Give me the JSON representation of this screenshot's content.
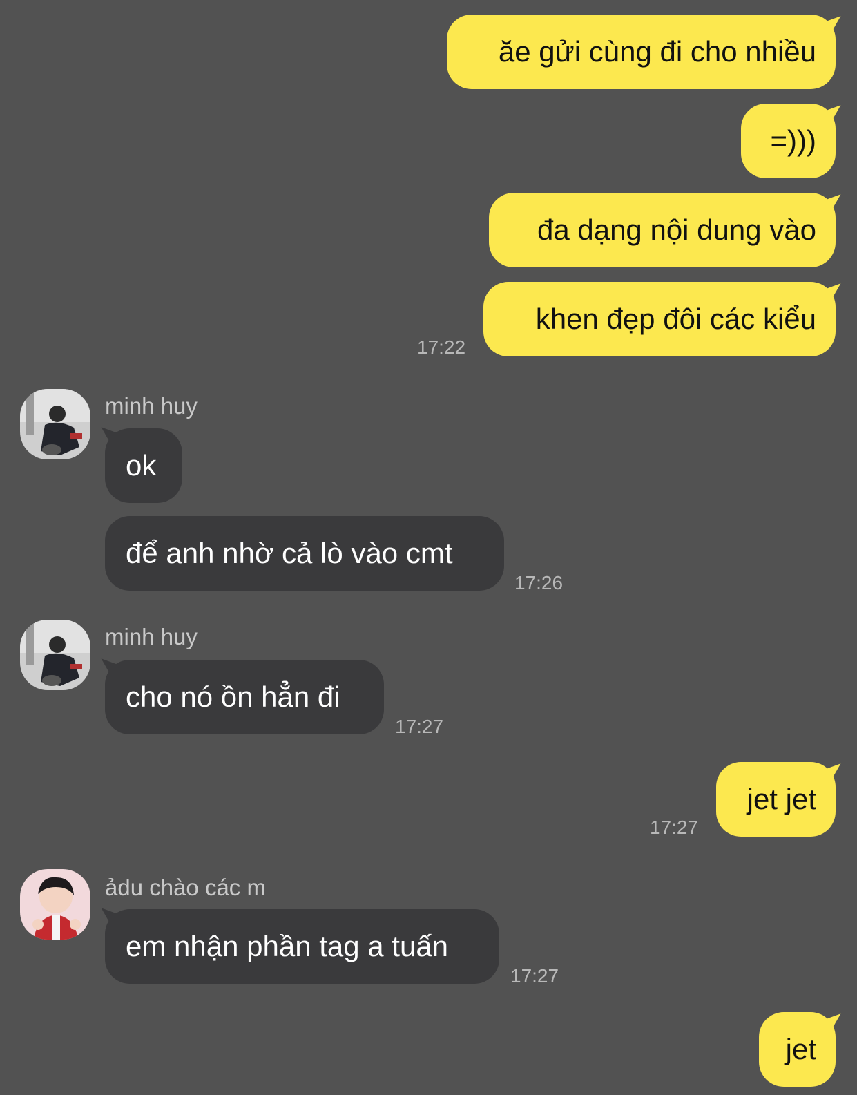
{
  "colors": {
    "background": "#525252",
    "outgoing_bubble": "#fce84f",
    "incoming_bubble": "#3a3a3c",
    "timestamp": "#b8b8b8",
    "sender_name": "#c9c9c9"
  },
  "messages": {
    "m1": {
      "text": "ăe gửi cùng đi cho nhiều"
    },
    "m2": {
      "text": "=)))"
    },
    "m3": {
      "text": "đa dạng nội dung vào"
    },
    "m4": {
      "text": "khen đẹp đôi các kiểu",
      "time": "17:22"
    },
    "g1": {
      "sender": "minh huy",
      "m5": {
        "text": "ok"
      },
      "m6": {
        "text": "để anh nhờ cả lò vào cmt",
        "time": "17:26"
      }
    },
    "g2": {
      "sender": "minh huy",
      "m7": {
        "text": "cho nó ồn hẳn đi",
        "time": "17:27"
      }
    },
    "m8": {
      "text": "jet jet",
      "time": "17:27"
    },
    "g3": {
      "sender": "ảdu chào các m",
      "m9": {
        "text": "em nhận phần tag a tuấn",
        "time": "17:27"
      }
    },
    "m10": {
      "text": "jet"
    }
  }
}
